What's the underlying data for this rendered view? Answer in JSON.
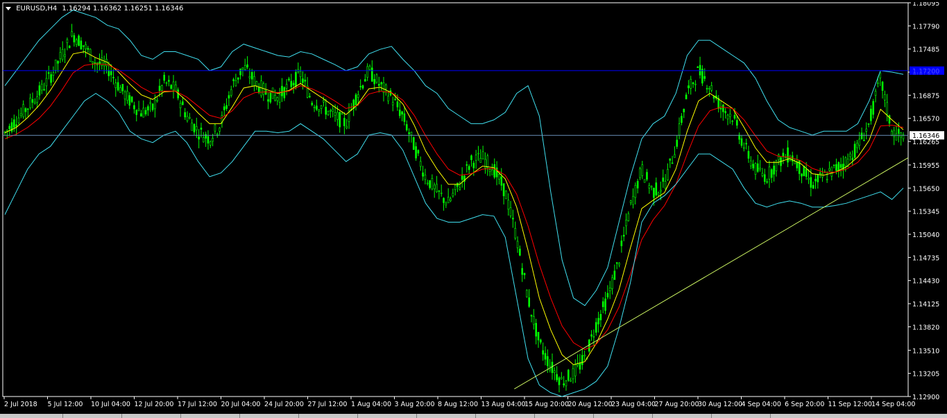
{
  "header": {
    "symbol": "EURUSD,H4",
    "ohlc": "1.16294 1.16362 1.16251 1.16346"
  },
  "colors": {
    "background": "#000000",
    "candle": "#00ff00",
    "axis": "#ffffff",
    "bollinger": "#40e0f0",
    "ma_fast": "#ffff00",
    "ma_slow": "#ff0000",
    "hline_blue": "#0000ff",
    "trendline": "#c8f060",
    "price_box_bg": "#ffffff",
    "blue_label_bg": "#0000ff"
  },
  "chart_data": {
    "type": "line",
    "ylim": [
      1.129,
      1.18095
    ],
    "y_ticks": [
      "1.18095",
      "1.17790",
      "1.17485",
      "1.17180",
      "1.16875",
      "1.16570",
      "1.16265",
      "1.15955",
      "1.15650",
      "1.15345",
      "1.15040",
      "1.14735",
      "1.14430",
      "1.14125",
      "1.13820",
      "1.13510",
      "1.13205",
      "1.12900"
    ],
    "x_ticks": [
      "2 Jul 2018",
      "5 Jul 12:00",
      "10 Jul 04:00",
      "12 Jul 20:00",
      "17 Jul 12:00",
      "20 Jul 04:00",
      "24 Jul 20:00",
      "27 Jul 12:00",
      "1 Aug 04:00",
      "3 Aug 20:00",
      "8 Aug 12:00",
      "13 Aug 04:00",
      "15 Aug 20:00",
      "20 Aug 12:00",
      "23 Aug 04:00",
      "27 Aug 20:00",
      "30 Aug 12:00",
      "4 Sep 04:00",
      "6 Sep 20:00",
      "11 Sep 12:00",
      "14 Sep 04:00"
    ],
    "current_price": "1.16346",
    "current_price_value": 1.16346,
    "blue_hline_label": "1.17200",
    "blue_hline_value": 1.172,
    "series": [
      {
        "name": "",
        "role": "close",
        "values": [
          1.1638,
          1.1655,
          1.1672,
          1.169,
          1.1712,
          1.174,
          1.1768,
          1.1752,
          1.173,
          1.1725,
          1.17,
          1.168,
          1.1665,
          1.167,
          1.1705,
          1.1695,
          1.166,
          1.164,
          1.163,
          1.165,
          1.17,
          1.1725,
          1.1705,
          1.169,
          1.1685,
          1.17,
          1.1715,
          1.168,
          1.1672,
          1.166,
          1.165,
          1.169,
          1.172,
          1.17,
          1.1685,
          1.166,
          1.162,
          1.158,
          1.156,
          1.1545,
          1.157,
          1.16,
          1.1605,
          1.159,
          1.156,
          1.15,
          1.142,
          1.136,
          1.133,
          1.131,
          1.132,
          1.134,
          1.1385,
          1.142,
          1.147,
          1.154,
          1.159,
          1.156,
          1.157,
          1.162,
          1.169,
          1.172,
          1.17,
          1.167,
          1.166,
          1.162,
          1.159,
          1.158,
          1.16,
          1.161,
          1.159,
          1.157,
          1.158,
          1.159,
          1.16,
          1.162,
          1.165,
          1.171,
          1.164,
          1.163
        ]
      },
      {
        "name": "",
        "role": "ma_fast",
        "values": [
          1.1638,
          1.1645,
          1.1658,
          1.1674,
          1.1694,
          1.1718,
          1.1742,
          1.1745,
          1.1737,
          1.1731,
          1.1718,
          1.1702,
          1.1688,
          1.1682,
          1.1692,
          1.1693,
          1.168,
          1.1664,
          1.165,
          1.165,
          1.1672,
          1.1697,
          1.17,
          1.1695,
          1.169,
          1.1694,
          1.1703,
          1.1693,
          1.1683,
          1.1672,
          1.1662,
          1.1675,
          1.1696,
          1.1698,
          1.1691,
          1.1676,
          1.1648,
          1.1614,
          1.159,
          1.157,
          1.157,
          1.1583,
          1.1594,
          1.1592,
          1.1577,
          1.154,
          1.1483,
          1.142,
          1.1378,
          1.1345,
          1.1332,
          1.1336,
          1.136,
          1.1392,
          1.1431,
          1.1486,
          1.1538,
          1.1549,
          1.1559,
          1.159,
          1.164,
          1.168,
          1.169,
          1.168,
          1.167,
          1.1645,
          1.1618,
          1.1599,
          1.1599,
          1.1604,
          1.1597,
          1.1584,
          1.1582,
          1.1586,
          1.1593,
          1.1606,
          1.1628,
          1.1669,
          1.1655,
          1.1642
        ]
      },
      {
        "name": "",
        "role": "ma_slow",
        "values": [
          1.163,
          1.1636,
          1.1645,
          1.1657,
          1.1673,
          1.1694,
          1.1717,
          1.1727,
          1.1729,
          1.1728,
          1.1721,
          1.171,
          1.1698,
          1.169,
          1.1693,
          1.1693,
          1.1685,
          1.1673,
          1.1661,
          1.1657,
          1.1667,
          1.1684,
          1.1691,
          1.1692,
          1.1691,
          1.1693,
          1.17,
          1.1696,
          1.1689,
          1.168,
          1.167,
          1.1674,
          1.1689,
          1.1693,
          1.1691,
          1.1681,
          1.1661,
          1.1634,
          1.161,
          1.159,
          1.1582,
          1.1584,
          1.159,
          1.1591,
          1.1582,
          1.1557,
          1.1515,
          1.1464,
          1.142,
          1.1383,
          1.1361,
          1.1352,
          1.1359,
          1.1378,
          1.1408,
          1.1451,
          1.1497,
          1.1523,
          1.1542,
          1.157,
          1.161,
          1.1647,
          1.1667,
          1.1672,
          1.167,
          1.1655,
          1.1634,
          1.1614,
          1.1607,
          1.1606,
          1.1601,
          1.1591,
          1.1586,
          1.1586,
          1.159,
          1.1599,
          1.1616,
          1.1647,
          1.1648,
          1.1645
        ]
      },
      {
        "name": "",
        "role": "bb_upper",
        "values": [
          1.17,
          1.172,
          1.174,
          1.176,
          1.1775,
          1.179,
          1.18,
          1.1795,
          1.179,
          1.178,
          1.1775,
          1.176,
          1.174,
          1.1735,
          1.1745,
          1.1745,
          1.174,
          1.1735,
          1.172,
          1.1725,
          1.1745,
          1.1755,
          1.175,
          1.1745,
          1.174,
          1.1738,
          1.1745,
          1.1742,
          1.1735,
          1.1728,
          1.172,
          1.1725,
          1.1742,
          1.1748,
          1.1752,
          1.1735,
          1.172,
          1.17,
          1.169,
          1.167,
          1.166,
          1.165,
          1.165,
          1.1655,
          1.1665,
          1.169,
          1.17,
          1.166,
          1.156,
          1.147,
          1.142,
          1.141,
          1.143,
          1.146,
          1.152,
          1.158,
          1.163,
          1.165,
          1.166,
          1.169,
          1.174,
          1.176,
          1.176,
          1.175,
          1.174,
          1.173,
          1.171,
          1.168,
          1.1655,
          1.1645,
          1.164,
          1.1635,
          1.164,
          1.164,
          1.164,
          1.165,
          1.168,
          1.172,
          1.1718,
          1.1715
        ]
      },
      {
        "name": "",
        "role": "bb_lower",
        "values": [
          1.153,
          1.156,
          1.159,
          1.161,
          1.162,
          1.164,
          1.166,
          1.168,
          1.169,
          1.168,
          1.1665,
          1.164,
          1.163,
          1.1625,
          1.1635,
          1.164,
          1.1625,
          1.16,
          1.158,
          1.1585,
          1.16,
          1.162,
          1.164,
          1.164,
          1.1638,
          1.164,
          1.165,
          1.164,
          1.163,
          1.1615,
          1.16,
          1.161,
          1.1635,
          1.1638,
          1.1635,
          1.1615,
          1.158,
          1.1545,
          1.1525,
          1.152,
          1.152,
          1.1525,
          1.153,
          1.1528,
          1.15,
          1.142,
          1.134,
          1.1305,
          1.1295,
          1.129,
          1.1295,
          1.13,
          1.131,
          1.133,
          1.138,
          1.144,
          1.152,
          1.1545,
          1.1555,
          1.157,
          1.159,
          1.161,
          1.161,
          1.16,
          1.159,
          1.1565,
          1.1545,
          1.154,
          1.1545,
          1.1548,
          1.1545,
          1.154,
          1.154,
          1.1542,
          1.1545,
          1.155,
          1.1555,
          1.156,
          1.155,
          1.1565
        ]
      }
    ],
    "trendline": {
      "from": [
        0.565,
        1.13
      ],
      "to": [
        1.0,
        1.1605
      ]
    },
    "grid": false,
    "legend": "none"
  },
  "bottom_tabs": [
    "",
    "",
    "",
    "",
    "",
    "",
    "",
    "",
    "",
    "",
    "",
    "",
    ""
  ]
}
